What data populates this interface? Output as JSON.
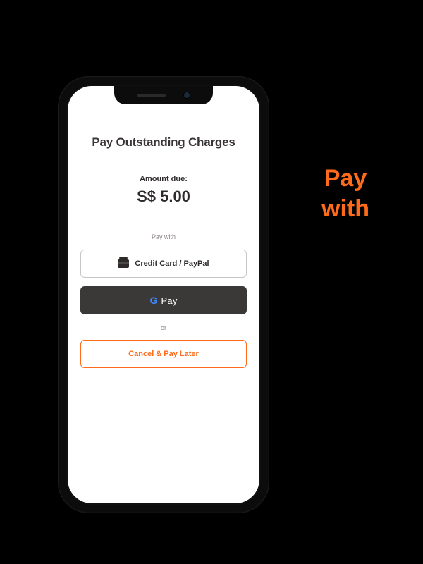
{
  "side_heading": {
    "line1": "Pay",
    "line2": "with"
  },
  "screen": {
    "title": "Pay Outstanding Charges",
    "amount_label": "Amount due:",
    "amount_value": "S$ 5.00",
    "pay_with_label": "Pay with",
    "credit_card_label": "Credit Card / PayPal",
    "gpay_label": "Pay",
    "or_label": "or",
    "cancel_label": "Cancel & Pay Later"
  },
  "colors": {
    "accent": "#ff6b1a",
    "dark_button": "#3b3937"
  }
}
